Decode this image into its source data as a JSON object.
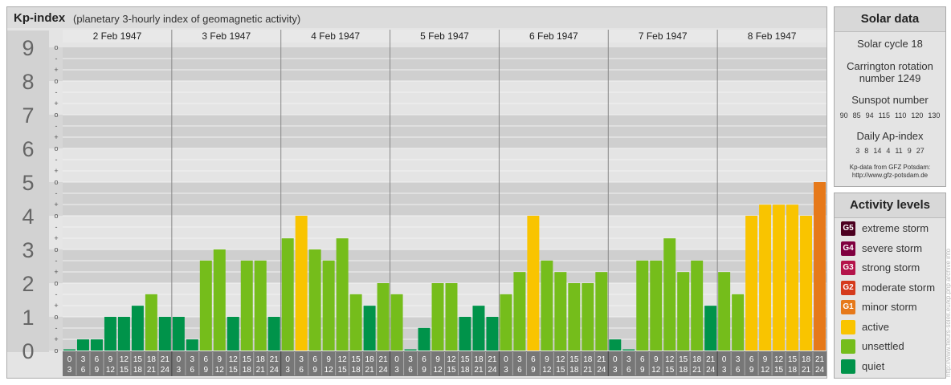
{
  "header": {
    "title": "Kp-index",
    "subtitle": "(planetary 3-hourly index of geomagnetic activity)"
  },
  "chart_data": {
    "type": "bar",
    "ylim": [
      0,
      9
    ],
    "y_ticks": [
      "0",
      "1",
      "2",
      "3",
      "4",
      "5",
      "6",
      "7",
      "8",
      "9"
    ],
    "y_minor_labels": [
      "-",
      "o",
      "+"
    ],
    "days": [
      "2 Feb 1947",
      "3 Feb 1947",
      "4 Feb 1947",
      "5 Feb 1947",
      "6 Feb 1947",
      "7 Feb 1947",
      "8 Feb 1947"
    ],
    "hour_start_labels": [
      "0",
      "3",
      "6",
      "9",
      "12",
      "15",
      "18",
      "21"
    ],
    "hour_end_labels": [
      "3",
      "6",
      "9",
      "12",
      "15",
      "18",
      "21",
      "24"
    ],
    "values": [
      0.0,
      0.33,
      0.33,
      1.0,
      1.0,
      1.33,
      1.67,
      1.0,
      1.0,
      0.33,
      2.67,
      3.0,
      1.0,
      2.67,
      2.67,
      1.0,
      3.33,
      4.0,
      3.0,
      2.67,
      3.33,
      1.67,
      1.33,
      2.0,
      1.67,
      0.0,
      0.67,
      2.0,
      2.0,
      1.0,
      1.33,
      1.0,
      1.67,
      2.33,
      4.0,
      2.67,
      2.33,
      2.0,
      2.0,
      2.33,
      0.33,
      0.0,
      2.67,
      2.67,
      3.33,
      2.33,
      2.67,
      1.33,
      2.33,
      1.67,
      4.0,
      4.33,
      4.33,
      4.33,
      4.0,
      5.0
    ],
    "colors": {
      "quiet": "#00934a",
      "unsettled": "#75bd1b",
      "active": "#f9c400",
      "minor": "#e6791a"
    }
  },
  "solar": {
    "title": "Solar data",
    "cycle": "Solar cycle 18",
    "rotation_line1": "Carrington rotation",
    "rotation_line2": "number 1249",
    "sunspot_title": "Sunspot number",
    "sunspot_values": [
      "90",
      "85",
      "94",
      "115",
      "110",
      "120",
      "130"
    ],
    "ap_title": "Daily Ap-index",
    "ap_values": [
      "3",
      "8",
      "14",
      "4",
      "11",
      "9",
      "27"
    ],
    "source_line1": "Kp-data from GFZ Potsdam:",
    "source_line2": "http://www.gfz-potsdam.de"
  },
  "levels": {
    "title": "Activity levels",
    "items": [
      {
        "badge": "G5",
        "label": "extreme storm",
        "color": "#4c0020"
      },
      {
        "badge": "G4",
        "label": "severe storm",
        "color": "#800040"
      },
      {
        "badge": "G3",
        "label": "strong storm",
        "color": "#b4144a"
      },
      {
        "badge": "G2",
        "label": "moderate storm",
        "color": "#d53a1c"
      },
      {
        "badge": "G1",
        "label": "minor storm",
        "color": "#e6791a"
      },
      {
        "badge": "",
        "label": "active",
        "color": "#f9c400"
      },
      {
        "badge": "",
        "label": "unsettled",
        "color": "#75bd1b"
      },
      {
        "badge": "",
        "label": "quiet",
        "color": "#00934a"
      }
    ]
  },
  "credit": "http://www.fleurs-soleil.eu/kp.php archive info"
}
